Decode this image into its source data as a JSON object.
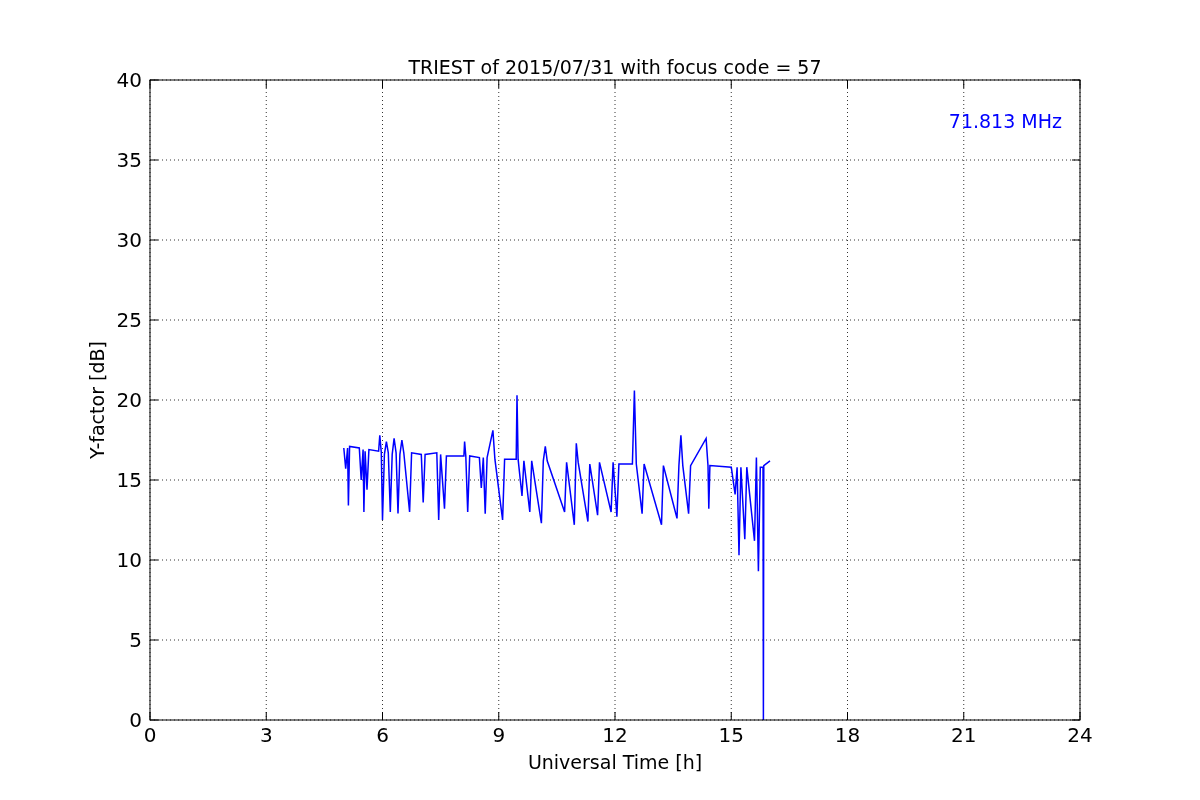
{
  "chart_data": {
    "type": "line",
    "title": "TRIEST of 2015/07/31 with focus code = 57",
    "xlabel": "Universal Time [h]",
    "ylabel": "Y-factor [dB]",
    "xlim": [
      0,
      24
    ],
    "ylim": [
      0,
      40
    ],
    "grid": true,
    "xticks": [
      0,
      3,
      6,
      9,
      12,
      15,
      18,
      21,
      24
    ],
    "yticks": [
      0,
      5,
      10,
      15,
      20,
      25,
      30,
      35,
      40
    ],
    "x": [
      5.0,
      5.05,
      5.1,
      5.12,
      5.15,
      5.4,
      5.45,
      5.5,
      5.52,
      5.55,
      5.6,
      5.65,
      5.9,
      5.93,
      5.97,
      6.0,
      6.05,
      6.1,
      6.15,
      6.2,
      6.25,
      6.3,
      6.35,
      6.4,
      6.45,
      6.5,
      6.55,
      6.7,
      6.75,
      7.0,
      7.05,
      7.1,
      7.4,
      7.45,
      7.5,
      7.6,
      7.65,
      8.1,
      8.12,
      8.15,
      8.2,
      8.25,
      8.5,
      8.55,
      8.6,
      8.65,
      8.7,
      8.85,
      8.9,
      9.1,
      9.15,
      9.45,
      9.47,
      9.5,
      9.6,
      9.65,
      9.8,
      9.85,
      10.1,
      10.15,
      10.2,
      10.25,
      10.7,
      10.75,
      10.95,
      11.0,
      11.05,
      11.3,
      11.35,
      11.55,
      11.6,
      11.9,
      11.95,
      12.05,
      12.1,
      12.45,
      12.5,
      12.55,
      12.7,
      12.75,
      13.2,
      13.25,
      13.6,
      13.65,
      13.7,
      13.75,
      13.9,
      13.95,
      14.35,
      14.4,
      14.42,
      14.45,
      15.0,
      15.1,
      15.15,
      15.2,
      15.25,
      15.35,
      15.4,
      15.6,
      15.65,
      15.7,
      15.75,
      15.82,
      15.83,
      15.84,
      16.0
    ],
    "series": [
      {
        "name": "71.813 MHz",
        "color": "#0000ff",
        "values": [
          17,
          15.7,
          17,
          13.4,
          17.1,
          17,
          15,
          16.9,
          13,
          16.8,
          14.4,
          16.9,
          16.8,
          17.8,
          16.7,
          12.5,
          16.6,
          17.4,
          16.7,
          13,
          16.6,
          17.6,
          16.7,
          12.9,
          16.6,
          17.5,
          16.7,
          13,
          16.7,
          16.6,
          13.6,
          16.6,
          16.7,
          12.5,
          16.6,
          13.2,
          16.5,
          16.5,
          17.4,
          16.5,
          13,
          16.5,
          16.4,
          14.5,
          16.4,
          12.9,
          16.4,
          18.1,
          16.3,
          12.5,
          16.3,
          16.3,
          20.3,
          16.3,
          14,
          16.2,
          13,
          16.2,
          12.3,
          16.2,
          17.1,
          16.2,
          13,
          16.1,
          12.2,
          17.3,
          16.1,
          12.4,
          16,
          12.8,
          16.1,
          13,
          16.1,
          12.7,
          16,
          16,
          20.6,
          16,
          12.9,
          16,
          12.2,
          15.9,
          12.6,
          15.9,
          17.8,
          15.9,
          12.9,
          15.9,
          17.6,
          15.9,
          13.2,
          15.9,
          15.8,
          14.1,
          15.8,
          10.3,
          15.8,
          11.3,
          15.8,
          11.2,
          16.4,
          9.3,
          15.8,
          15.8,
          0,
          15.9,
          16.2
        ]
      }
    ]
  }
}
